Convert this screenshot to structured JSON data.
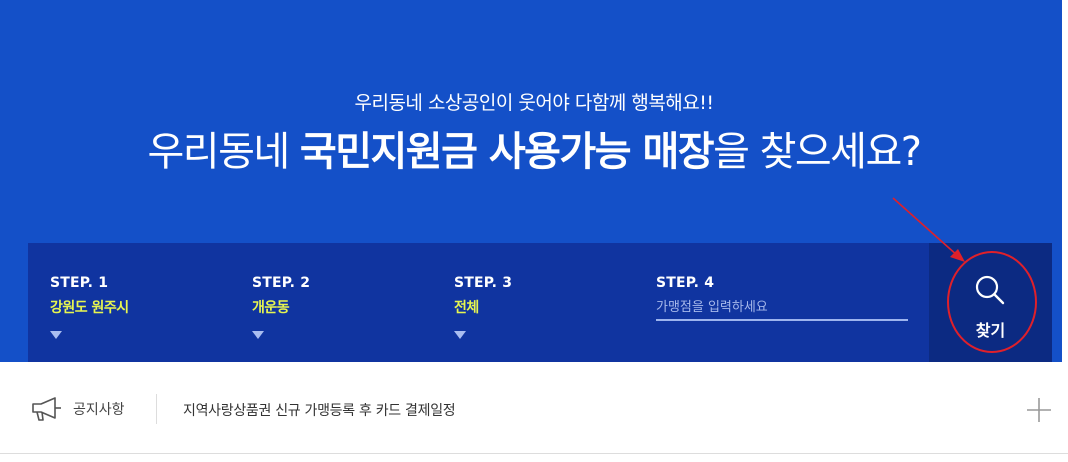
{
  "hero": {
    "subtitle": "우리동네 소상공인이 웃어야 다함께 행복해요!!",
    "headline_prefix": "우리동네 ",
    "headline_bold": "국민지원금 사용가능 매장",
    "headline_suffix": "을 찾으세요?"
  },
  "search": {
    "steps": [
      {
        "label": "STEP. 1",
        "value": "강원도 원주시"
      },
      {
        "label": "STEP. 2",
        "value": "개운동"
      },
      {
        "label": "STEP. 3",
        "value": "전체"
      },
      {
        "label": "STEP. 4",
        "value": ""
      }
    ],
    "name_placeholder": "가맹점을 입력하세요",
    "find_label": "찾기"
  },
  "notice": {
    "label": "공지사항",
    "text": "지역사랑상품권 신규 가맹등록 후 카드 결제일정"
  },
  "icons": {
    "megaphone": "megaphone-icon",
    "search": "search-icon",
    "plus": "plus-icon",
    "caret": "caret-down-icon"
  },
  "colors": {
    "hero_bg": "#1450c8",
    "bar_bg": "#1034a0",
    "button_bg": "#0c2a82",
    "highlight": "#e6f550",
    "annotation": "#e0202a"
  }
}
